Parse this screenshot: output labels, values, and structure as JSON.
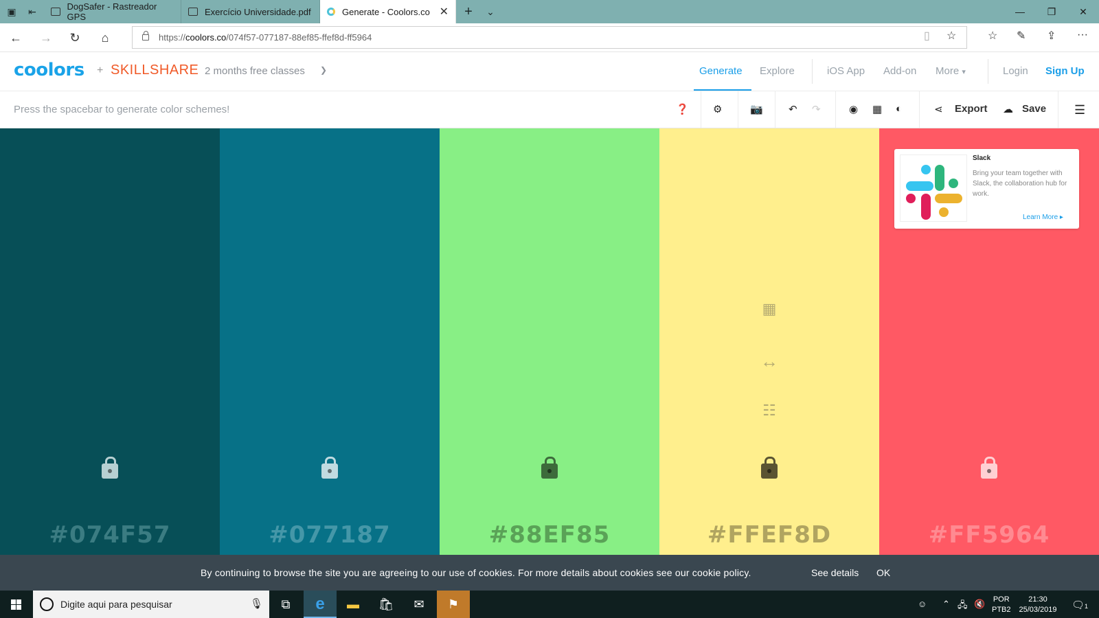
{
  "browser": {
    "tabs": [
      {
        "title": "DogSafer - Rastreador GPS"
      },
      {
        "title": "Exercício Universidade.pdf"
      },
      {
        "title": "Generate - Coolors.co"
      }
    ],
    "url_prefix": "https://",
    "url_domain": "coolors.co",
    "url_path": "/074f57-077187-88ef85-ffef8d-ff5964"
  },
  "site": {
    "logo": "coolors",
    "partner_plus": "+",
    "partner": "SKILLSHARE",
    "promo": "2 months free classes",
    "nav": {
      "generate": "Generate",
      "explore": "Explore",
      "ios_app": "iOS App",
      "addon": "Add-on",
      "more": "More",
      "login": "Login",
      "signup": "Sign Up"
    }
  },
  "toolbar": {
    "hint": "Press the spacebar to generate color schemes!",
    "export": "Export",
    "save": "Save"
  },
  "palette": {
    "colors": [
      {
        "hex": "#074F57",
        "bg": "#074f57",
        "text": "#3b7c82",
        "lock": "#b7d0d2"
      },
      {
        "hex": "#077187",
        "bg": "#077187",
        "text": "#4597a8",
        "lock": "#c0dbe1"
      },
      {
        "hex": "#88EF85",
        "bg": "#88ef85",
        "text": "#5aa257",
        "lock": "#3d6b3b"
      },
      {
        "hex": "#FFEF8D",
        "bg": "#ffef8d",
        "text": "#b0a460",
        "lock": "#5a5432"
      },
      {
        "hex": "#FF5964",
        "bg": "#ff5964",
        "text": "#ff8a91",
        "lock": "#ffd0d3"
      }
    ]
  },
  "ad": {
    "title": "Slack",
    "body": "Bring your team together with Slack, the collaboration hub for work.",
    "cta": "Learn More"
  },
  "cookie": {
    "text": "By continuing to browse the site you are agreeing to our use of cookies. For more details about cookies see our cookie policy.",
    "details": "See details",
    "ok": "OK"
  },
  "taskbar": {
    "search_placeholder": "Digite aqui para pesquisar",
    "lang_line1": "POR",
    "lang_line2": "PTB2",
    "time": "21:30",
    "date": "25/03/2019",
    "notification_count": "1"
  }
}
